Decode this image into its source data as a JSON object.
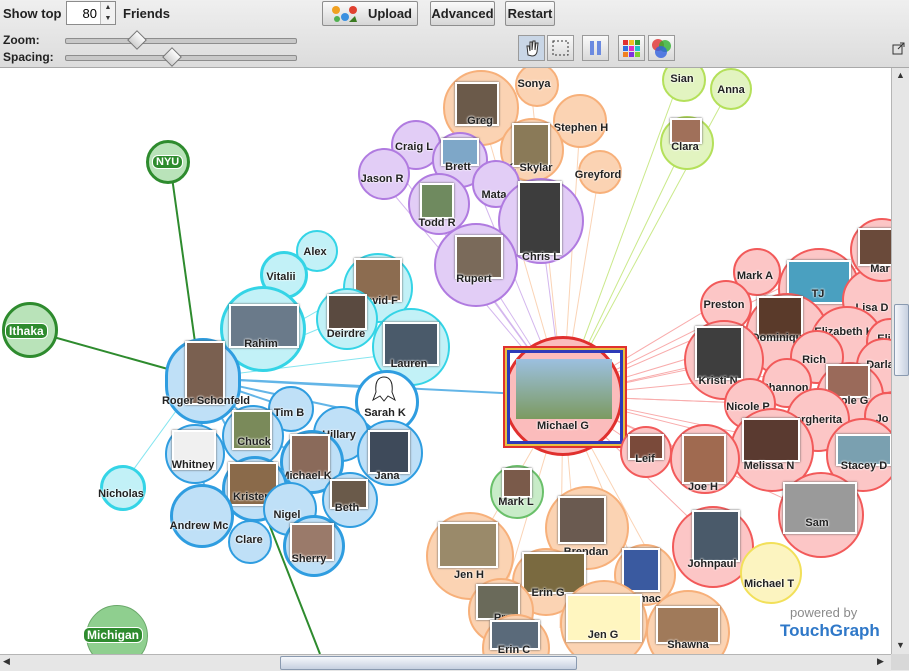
{
  "toolbar": {
    "show_top_label": "Show top",
    "show_top_value": "80",
    "friends_label": "Friends",
    "upload_label": "Upload",
    "advanced_label": "Advanced",
    "restart_label": "Restart",
    "zoom_label": "Zoom:",
    "spacing_label": "Spacing:",
    "zoom_level": 0.3,
    "spacing_level": 0.45
  },
  "graph": {
    "colors": {
      "green": "#2e8b2e",
      "cyan": "#34d4e6",
      "blue": "#2f9de0",
      "purple": "#b07be0",
      "orange": "#f7b07a",
      "red": "#f25a5a",
      "yellowgreen": "#b4e05a",
      "yellow": "#f2e05a",
      "center": "#e0302e"
    },
    "networks": [
      "NYU",
      "Ithaka",
      "Michigan"
    ],
    "friends": [
      "Sonya",
      "Greg",
      "Stephen H",
      "Craig L",
      "Brett",
      "K. Skylar",
      "Greyford",
      "Jason R",
      "Mata",
      "Todd R",
      "Chris L",
      "Rupert",
      "Sian",
      "Anna",
      "Clara",
      "Alex",
      "Vitalii",
      "David F",
      "Deirdre",
      "Rahim",
      "Lauren",
      "Roger Schonfeld",
      "Tim B",
      "Sarah K",
      "Hillary",
      "Chuck",
      "Whitney",
      "Michael K",
      "Jana",
      "Nicholas",
      "Kristen",
      "Andrew Mc",
      "Nigel",
      "Beth",
      "Clare",
      "Sherry",
      "Michael G",
      "Mark A",
      "Preston",
      "TJ",
      "Lisa D",
      "Mar",
      "Dominique",
      "Elizabeth K",
      "Eli",
      "Rich",
      "Darla",
      "Kristi N",
      "Shannon",
      "Nicole P",
      "Nicole G",
      "Margherita",
      "Jo",
      "Leif",
      "Melissa N",
      "Stacey D",
      "Joe H",
      "Sam",
      "Mark L",
      "Brendan",
      "Johnpaul",
      "Michael T",
      "Jen H",
      "Erin G",
      "mac",
      "Pru",
      "Jen G",
      "Shawna",
      "Erin C"
    ],
    "powered_by": "powered by",
    "brand": "TouchGraph"
  }
}
